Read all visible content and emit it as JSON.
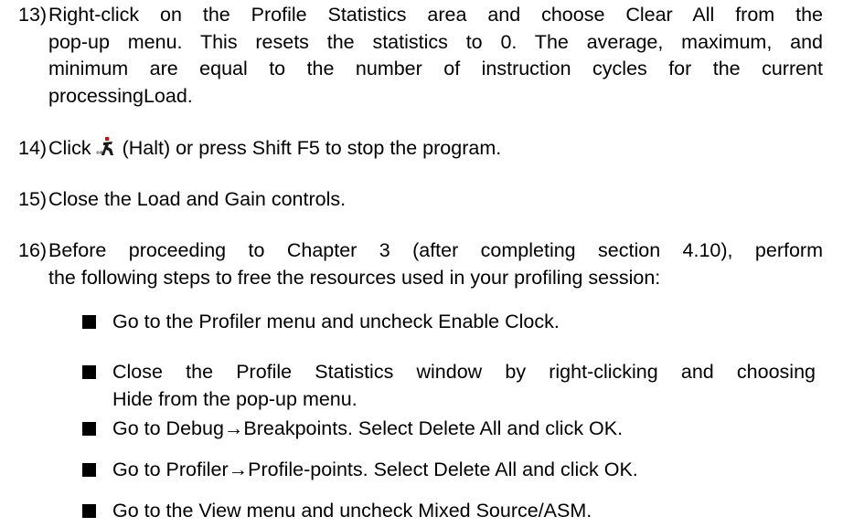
{
  "steps": [
    {
      "num": "13)",
      "lines": [
        "Right-click on the Profile Statistics area and choose Clear All from the",
        "pop-up menu. This resets the statistics to 0. The average, maximum, and",
        "minimum are equal to the number of instruction cycles for the current",
        "processingLoad."
      ]
    },
    {
      "num": "14)",
      "before_icon": "Click",
      "icon": "halt-icon",
      "after_icon": "(Halt) or press Shift F5 to stop the program."
    },
    {
      "num": "15)",
      "lines": [
        "Close the Load and Gain controls."
      ]
    },
    {
      "num": "16)",
      "lines": [
        "Before proceeding to Chapter 3 (after completing section 4.10), perform",
        "the following steps to free the resources used in your profiling session:"
      ]
    }
  ],
  "bullets": [
    {
      "lines": [
        "Go to the Profiler menu and uncheck Enable Clock."
      ]
    },
    {
      "lines": [
        "Close the Profile Statistics window by right-clicking and choosing",
        "Hide from the pop-up menu."
      ]
    },
    {
      "lines": [
        "Go to Debug→Breakpoints. Select Delete All and click OK."
      ]
    },
    {
      "lines": [
        "Go to Profiler→Profile-points. Select Delete All and click OK."
      ]
    },
    {
      "lines": [
        "Go to the View menu and uncheck Mixed Source/ASM."
      ]
    }
  ]
}
